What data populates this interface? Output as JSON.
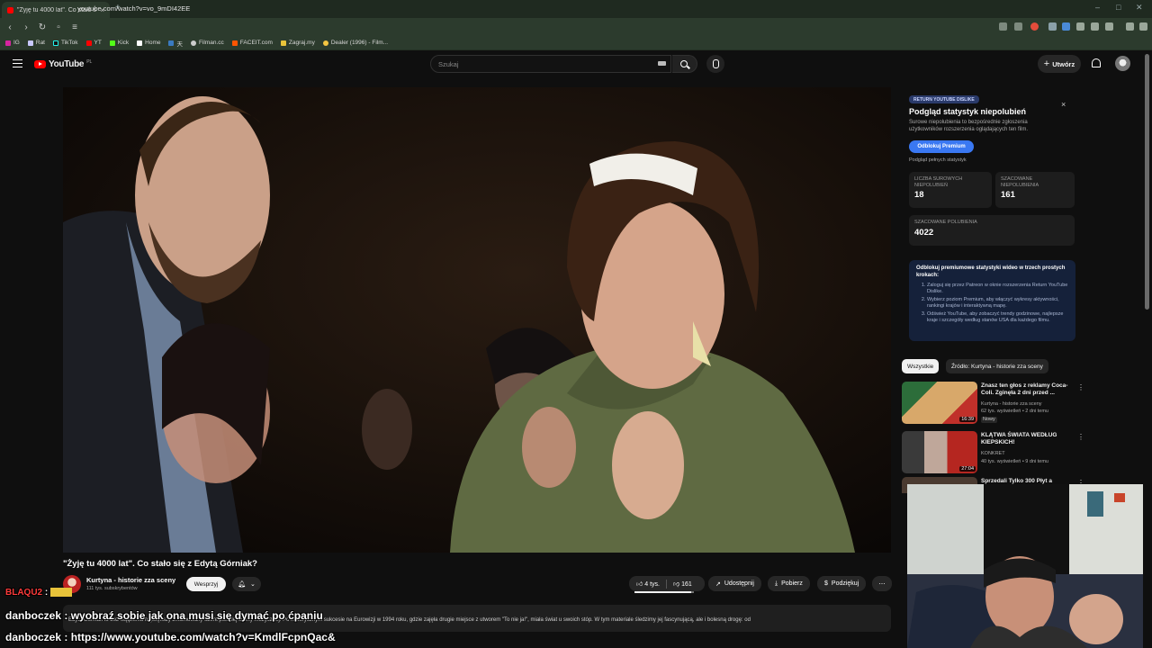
{
  "browser": {
    "tab_title": "\"Żyję tu 4000 lat\". Co stało się",
    "url": "youtube.com/watch?v=vo_9mDI42EE",
    "bookmarks": [
      "IG",
      "Rat",
      "TikTok",
      "YT",
      "Kick",
      "Home",
      "天",
      "Filman.cc",
      "FACEIT.com",
      "Zagraj.my",
      "Dealer (1996) - Film..."
    ]
  },
  "header": {
    "logo": "YouTube",
    "logo_region": "PL",
    "search_placeholder": "Szukaj",
    "create_label": "Utwórz"
  },
  "ryd": {
    "tag": "RETURN YOUTUBE DISLIKE",
    "title": "Podgląd statystyk niepolubień",
    "description": "Surowe niepolubienia to bezpośrednie zgłoszenia użytkowników rozszerzenia oglądających ten film.",
    "unlock_label": "Odblokuj Premium",
    "preview_note": "Podgląd pełnych statystyk",
    "stats": [
      {
        "label": "LICZBA SUROWYCH NIEPOLUBIEŃ",
        "value": "18"
      },
      {
        "label": "SZACOWANE NIEPOLUBIENIA",
        "value": "161"
      },
      {
        "label": "SZACOWANE POLUBIENIA",
        "value": "4022"
      }
    ],
    "steps_title": "Odblokuj premiumowe statystyki wideo w trzech prostych krokach:",
    "steps": [
      "Zaloguj się przez Patreon w oknie rozszerzenia Return YouTube Dislike.",
      "Wybierz poziom Premium, aby włączyć wykresy aktywności, rankingi krajów i interaktywną mapę.",
      "Odśwież YouTube, aby zobaczyć trendy godzinowe, najlepsze kraje i szczegóły według stanów USA dla każdego filmu."
    ]
  },
  "chips": [
    "Wszystkie",
    "Źródło: Kurtyna - historie zza sceny"
  ],
  "recommendations": [
    {
      "title": "Znasz ten głos z reklamy Coca-Coli. Zginęła 2 dni przed ...",
      "channel": "Kurtyna - historie zza sceny",
      "meta": "62 tys. wyświetleń • 2 dni temu",
      "badge": "Nowy",
      "duration": "16:39"
    },
    {
      "title": "KLĄTWA ŚWIATA WEDŁUG KIEPSKICH!",
      "channel": "KONKRET",
      "meta": "40 tys. wyświetleń • 9 dni temu",
      "badge": "",
      "duration": "27:04"
    },
    {
      "title": "Sprzedali Tylko 300 Płyt a",
      "channel": "",
      "meta": "",
      "badge": "",
      "duration": ""
    }
  ],
  "video": {
    "title": "\"Żyję tu 4000 lat\". Co stało się z Edytą Górniak?",
    "channel": "Kurtyna - historie zza sceny",
    "subscribers": "111 tys. subskrybentów",
    "support_label": "Wesprzyj",
    "likes": "4 tys.",
    "dislikes": "161",
    "like_ratio": 0.96,
    "share_label": "Udostępnij",
    "download_label": "Pobierz",
    "thanks_label": "Podziękuj",
    "description": "Edyta Górniak to bez wątpienia największy zmarnowany talent polskiej sceny muzycznej. Po historycznym sukcesie na Eurowizji w 1994 roku, gdzie zajęła drugie miejsce z utworem \"To nie ja!\", miała świat u swoich stóp. W tym materiale śledzimy jej fascynującą, ale i bolesną drogę: od"
  },
  "chat": [
    {
      "user": "BLAQU2",
      "message": ""
    },
    {
      "user": "danboczek",
      "message": "wyobraź sobie jak ona musi się dymać po ćpaniu"
    },
    {
      "user": "danboczek",
      "message": "https://www.youtube.com/watch?v=KmdlFcpnQac&"
    }
  ],
  "colors": {
    "accent": "#ff0000",
    "ryd_button": "#3a78f2",
    "chat_user_red": "#ff3b3b"
  }
}
